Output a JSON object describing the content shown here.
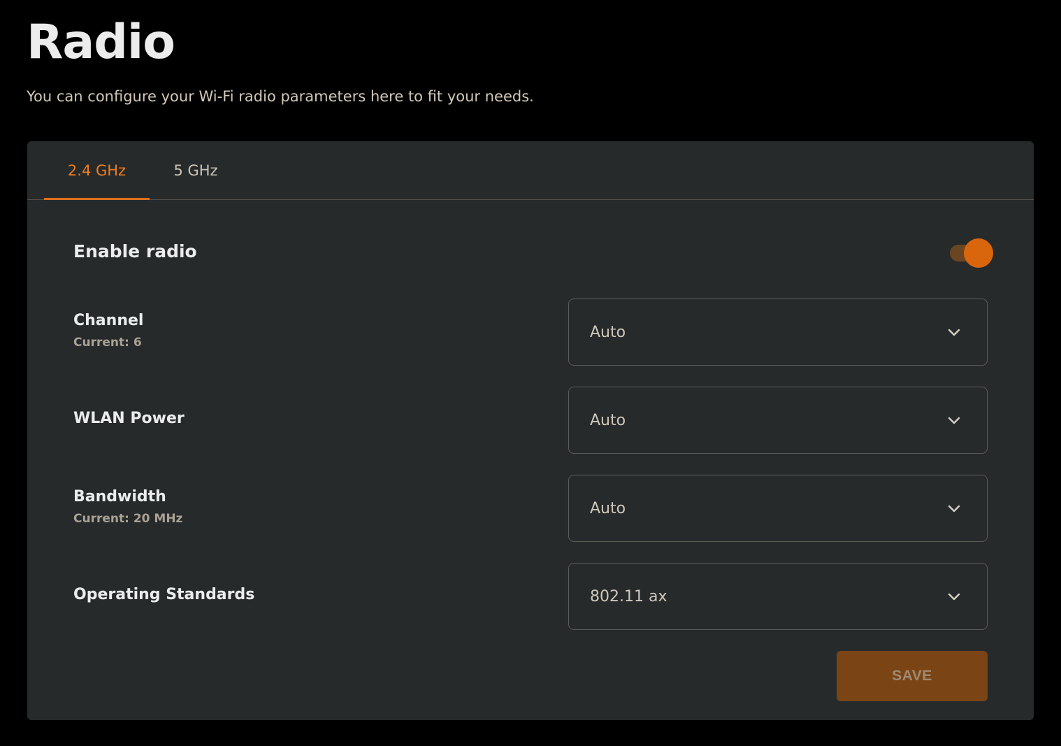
{
  "header": {
    "title": "Radio",
    "subtitle": "You can configure your Wi-Fi radio parameters here to fit your needs."
  },
  "tabs": [
    {
      "label": "2.4 GHz",
      "active": true
    },
    {
      "label": "5 GHz",
      "active": false
    }
  ],
  "enable_radio": {
    "label": "Enable radio",
    "enabled": true
  },
  "fields": {
    "channel": {
      "label": "Channel",
      "current": "Current: 6",
      "value": "Auto"
    },
    "wlan_power": {
      "label": "WLAN Power",
      "value": "Auto"
    },
    "bandwidth": {
      "label": "Bandwidth",
      "current": "Current: 20 MHz",
      "value": "Auto"
    },
    "operating_standards": {
      "label": "Operating Standards",
      "value": "802.11 ax"
    }
  },
  "save_label": "SAVE",
  "colors": {
    "accent": "#ec7d20",
    "card_background": "#262a2b",
    "page_background": "#000000",
    "save_button": "#7a4415"
  },
  "icons": {
    "select_chevron": "chevron-down-icon"
  }
}
